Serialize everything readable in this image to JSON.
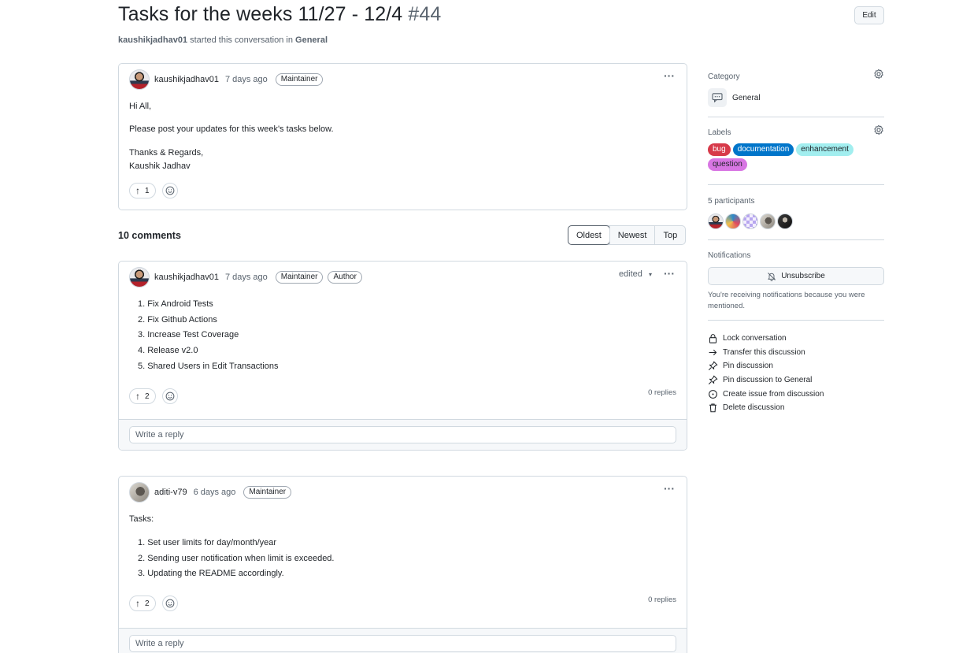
{
  "header": {
    "title": "Tasks for the weeks 11/27 - 12/4",
    "number": "#44",
    "edit_label": "Edit",
    "starter": "kaushikjadhav01",
    "started_text": " started this conversation in ",
    "category": "General"
  },
  "original_post": {
    "author": "kaushikjadhav01",
    "time": "7 days ago",
    "badge": "Maintainer",
    "lines": [
      "Hi All,",
      "Please post your updates for this week's tasks below.",
      "Thanks & Regards,",
      "Kaushik Jadhav"
    ],
    "upvotes": "1"
  },
  "comments_header": {
    "count_label": "10 comments",
    "sort_options": [
      "Oldest",
      "Newest",
      "Top"
    ],
    "active_sort": "Oldest"
  },
  "comments": [
    {
      "author": "kaushikjadhav01",
      "time": "7 days ago",
      "badges": [
        "Maintainer",
        "Author"
      ],
      "edited_label": "edited",
      "list": [
        "Fix Android Tests",
        "Fix Github Actions",
        "Increase Test Coverage",
        "Release v2.0",
        "Shared Users in Edit Transactions"
      ],
      "upvotes": "2",
      "replies": "0 replies",
      "reply_placeholder": "Write a reply"
    },
    {
      "author": "aditi-v79",
      "time": "6 days ago",
      "badges": [
        "Maintainer"
      ],
      "intro": "Tasks:",
      "list": [
        "Set user limits for day/month/year",
        "Sending user notification when limit is exceeded.",
        "Updating the README accordingly."
      ],
      "upvotes": "2",
      "replies": "0 replies",
      "reply_placeholder": "Write a reply"
    }
  ],
  "sidebar": {
    "category_label": "Category",
    "category_value": "General",
    "labels_label": "Labels",
    "labels": [
      {
        "name": "bug",
        "bg": "#d73a4a",
        "fg": "#ffffff"
      },
      {
        "name": "documentation",
        "bg": "#0075ca",
        "fg": "#ffffff"
      },
      {
        "name": "enhancement",
        "bg": "#a2eeef",
        "fg": "#1f2328"
      },
      {
        "name": "question",
        "bg": "#d876e3",
        "fg": "#1f2328"
      }
    ],
    "participants_label": "5 participants",
    "notifications_label": "Notifications",
    "unsubscribe_label": "Unsubscribe",
    "notif_text": "You're receiving notifications because you were mentioned.",
    "actions": [
      {
        "label": "Lock conversation",
        "icon": "lock-icon"
      },
      {
        "label": "Transfer this discussion",
        "icon": "arrow-right-icon"
      },
      {
        "label": "Pin discussion",
        "icon": "pin-icon"
      },
      {
        "label": "Pin discussion to General",
        "icon": "pin-icon"
      },
      {
        "label": "Create issue from discussion",
        "icon": "issue-opened-icon"
      },
      {
        "label": "Delete discussion",
        "icon": "trash-icon"
      }
    ]
  }
}
